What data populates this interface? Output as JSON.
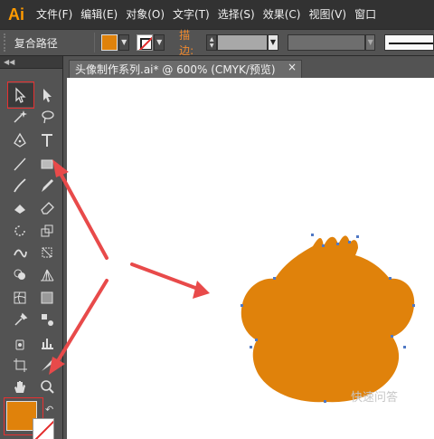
{
  "app": {
    "logo": "Ai",
    "menus": [
      "文件(F)",
      "编辑(E)",
      "对象(O)",
      "文字(T)",
      "选择(S)",
      "效果(C)",
      "视图(V)",
      "窗口"
    ]
  },
  "control_bar": {
    "selection_label": "复合路径",
    "stroke_label": "描边:",
    "fill_color": "#e0820b"
  },
  "document": {
    "tab_title": "头像制作系列.ai* @ 600% (CMYK/预览)",
    "close_glyph": "×"
  },
  "toolbox": {
    "active_tool": "selection-tool",
    "fill_color": "#e0820b",
    "stroke": "none"
  },
  "artwork": {
    "fill_color": "#e0820b",
    "path_color": "#4f78c4"
  },
  "annotations": {
    "arrow_color": "#e84a4a"
  },
  "watermark": "快速问答"
}
